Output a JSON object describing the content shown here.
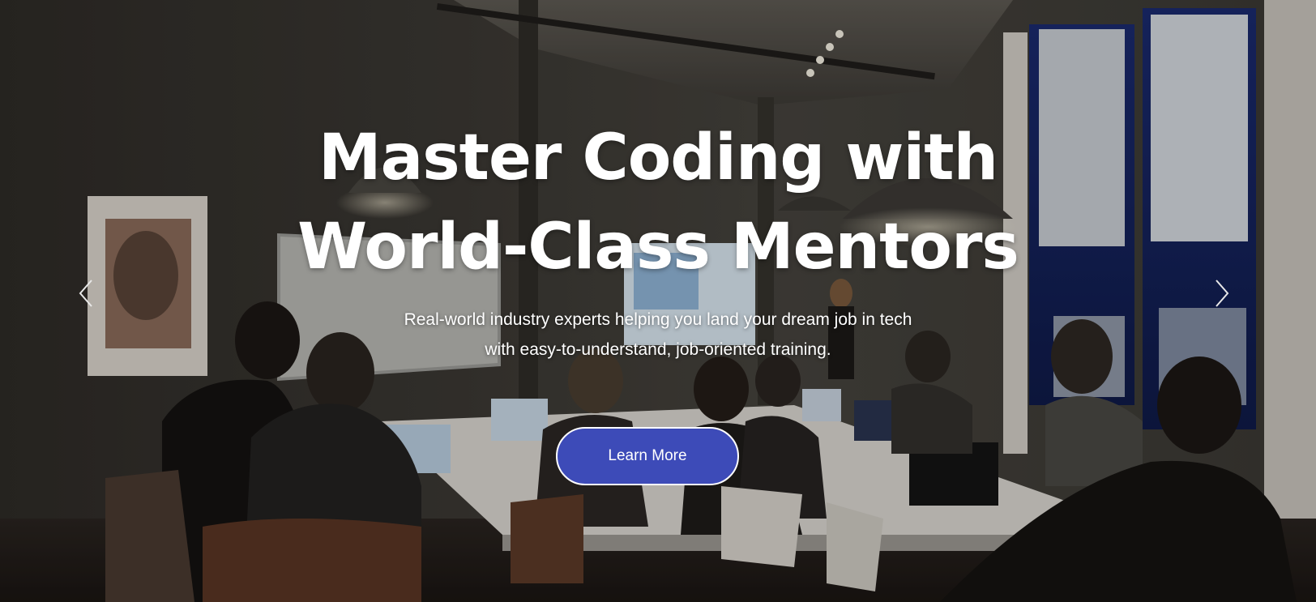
{
  "hero": {
    "headline_line1": "Master Coding with",
    "headline_line2": "World-Class Mentors",
    "subtitle": "Real-world industry experts helping you land your dream job in tech with easy-to-understand, job-oriented training.",
    "cta_label": "Learn More"
  },
  "carousel": {
    "prev_icon": "chevron-left-icon",
    "next_icon": "chevron-right-icon"
  },
  "colors": {
    "cta_background": "#3d4bb8",
    "cta_border": "#ffffff",
    "text": "#ffffff"
  }
}
